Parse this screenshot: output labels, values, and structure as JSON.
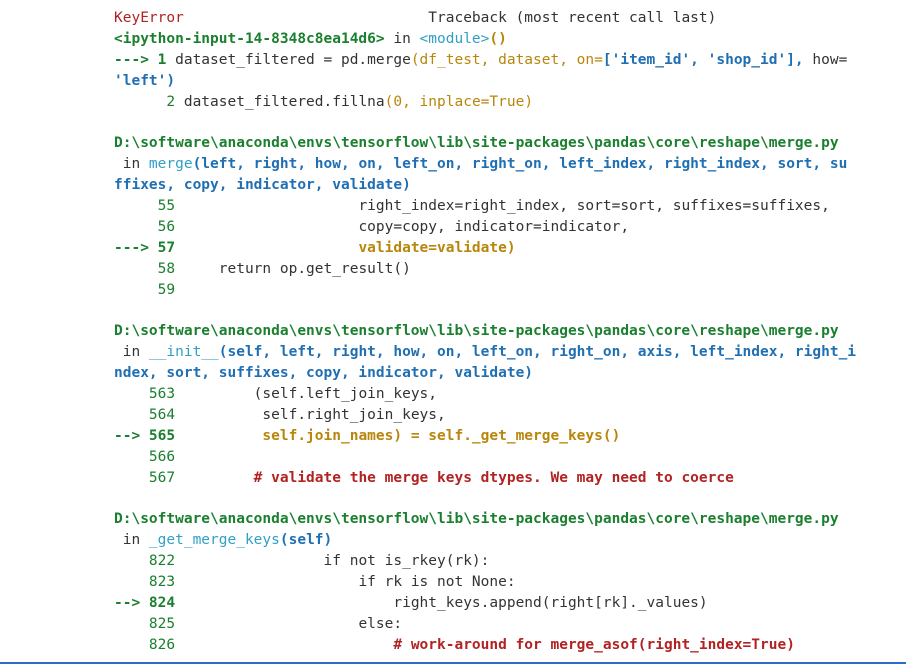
{
  "header": {
    "error_name": "KeyError",
    "traceback_label": "                            Traceback (most recent call last)"
  },
  "frame1": {
    "source": "<ipython-input-14-8348c8ea14d6>",
    "in_word": " in ",
    "func": "<module>",
    "func_paren": "()",
    "line1_arrow": "---> 1 ",
    "line1_code_a": "dataset_filtered = pd.merge",
    "line1_code_b": "(df_test, dataset, on=",
    "line1_code_c": "['item_id', 'shop_id'],",
    "line1_code_d": " how=",
    "line1_cont": "'left')",
    "line2_num": "      2 ",
    "line2_code_a": "dataset_filtered.fillna",
    "line2_code_b": "(0, inplace=True)"
  },
  "frame2": {
    "path": "D:\\software\\anaconda\\envs\\tensorflow\\lib\\site-packages\\pandas\\core\\reshape\\merge.py",
    "sig_in": " in ",
    "sig_func": "merge",
    "sig_args_1": "(left, right, how, on, left_on, right_on, left_index, right_index, sort, su",
    "sig_args_2": "ffixes, copy, indicator, validate)",
    "lines": [
      {
        "num": "     55 ",
        "code": "                    right_index=right_index, sort=sort, suffixes=suffixes,"
      },
      {
        "num": "     56 ",
        "code": "                    copy=copy, indicator=indicator,"
      },
      {
        "num": "---> 57 ",
        "code": "                    validate=validate)"
      },
      {
        "num": "     58 ",
        "code": "    return op.get_result()"
      },
      {
        "num": "     59 ",
        "code": ""
      }
    ]
  },
  "frame3": {
    "path": "D:\\software\\anaconda\\envs\\tensorflow\\lib\\site-packages\\pandas\\core\\reshape\\merge.py",
    "sig_in": " in ",
    "sig_func": "__init__",
    "sig_args_1": "(self, left, right, how, on, left_on, right_on, axis, left_index, right_i",
    "sig_args_2": "ndex, sort, suffixes, copy, indicator, validate)",
    "lines": [
      {
        "num": "    563 ",
        "code": "        (self.left_join_keys,"
      },
      {
        "num": "    564 ",
        "code": "         self.right_join_keys,"
      },
      {
        "num": "--> 565 ",
        "code": "         self.join_names) = self._get_merge_keys()"
      },
      {
        "num": "    566 ",
        "code": ""
      },
      {
        "num": "    567 ",
        "code": "        # validate the merge keys dtypes. We may need to coerce"
      }
    ]
  },
  "frame4": {
    "path": "D:\\software\\anaconda\\envs\\tensorflow\\lib\\site-packages\\pandas\\core\\reshape\\merge.py",
    "sig_in": " in ",
    "sig_func": "_get_merge_keys",
    "sig_args_1": "(self)",
    "lines": [
      {
        "num": "    822 ",
        "code": "                if not is_rkey(rk):"
      },
      {
        "num": "    823 ",
        "code": "                    if rk is not None:"
      },
      {
        "num": "--> 824 ",
        "code": "                        right_keys.append(right[rk]._values)"
      },
      {
        "num": "    825 ",
        "code": "                    else:"
      },
      {
        "num": "    826 ",
        "code": "                        # work-around for merge_asof(right_index=True)"
      }
    ]
  }
}
